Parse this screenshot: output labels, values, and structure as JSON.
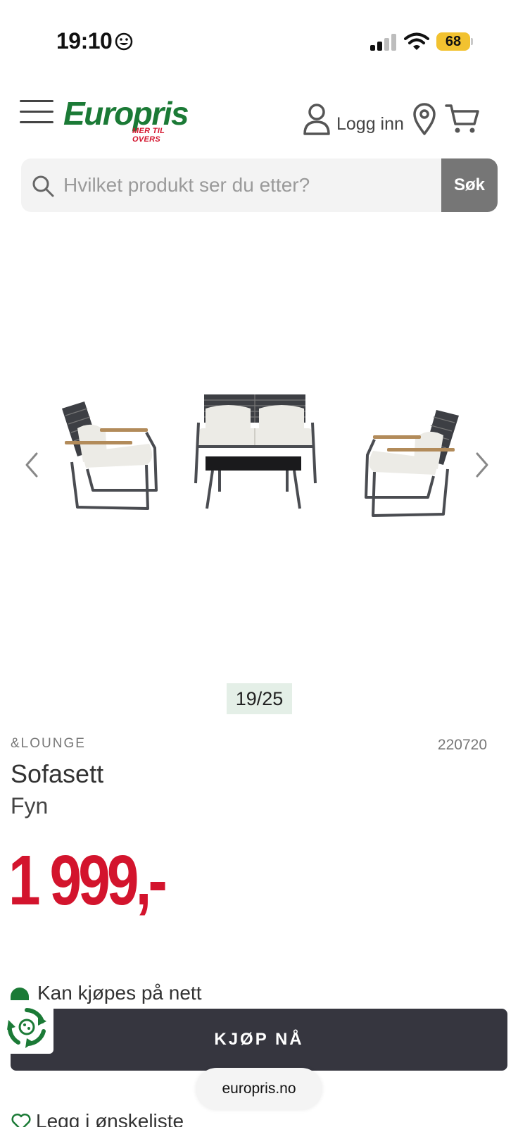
{
  "status_bar": {
    "time": "19:10",
    "battery": "68"
  },
  "header": {
    "logo_text": "Europris",
    "logo_tagline": "MER TIL OVERS",
    "login_label": "Logg inn"
  },
  "search": {
    "placeholder": "Hvilket produkt ser du etter?",
    "button_label": "Søk"
  },
  "gallery": {
    "counter": "19/25"
  },
  "product": {
    "brand": "&LOUNGE",
    "sku": "220720",
    "name": "Sofasett",
    "variant": "Fyn",
    "price": "1 999,-",
    "availability": "Kan kjøpes på nett",
    "buy_label": "KJØP NÅ",
    "wishlist_label": "Legg i ønskeliste"
  },
  "browser": {
    "url": "europris.no"
  },
  "colors": {
    "brand_green": "#1b7a36",
    "price_red": "#d3142d",
    "buy_button": "#36363f",
    "counter_bg": "#e4efe7"
  }
}
